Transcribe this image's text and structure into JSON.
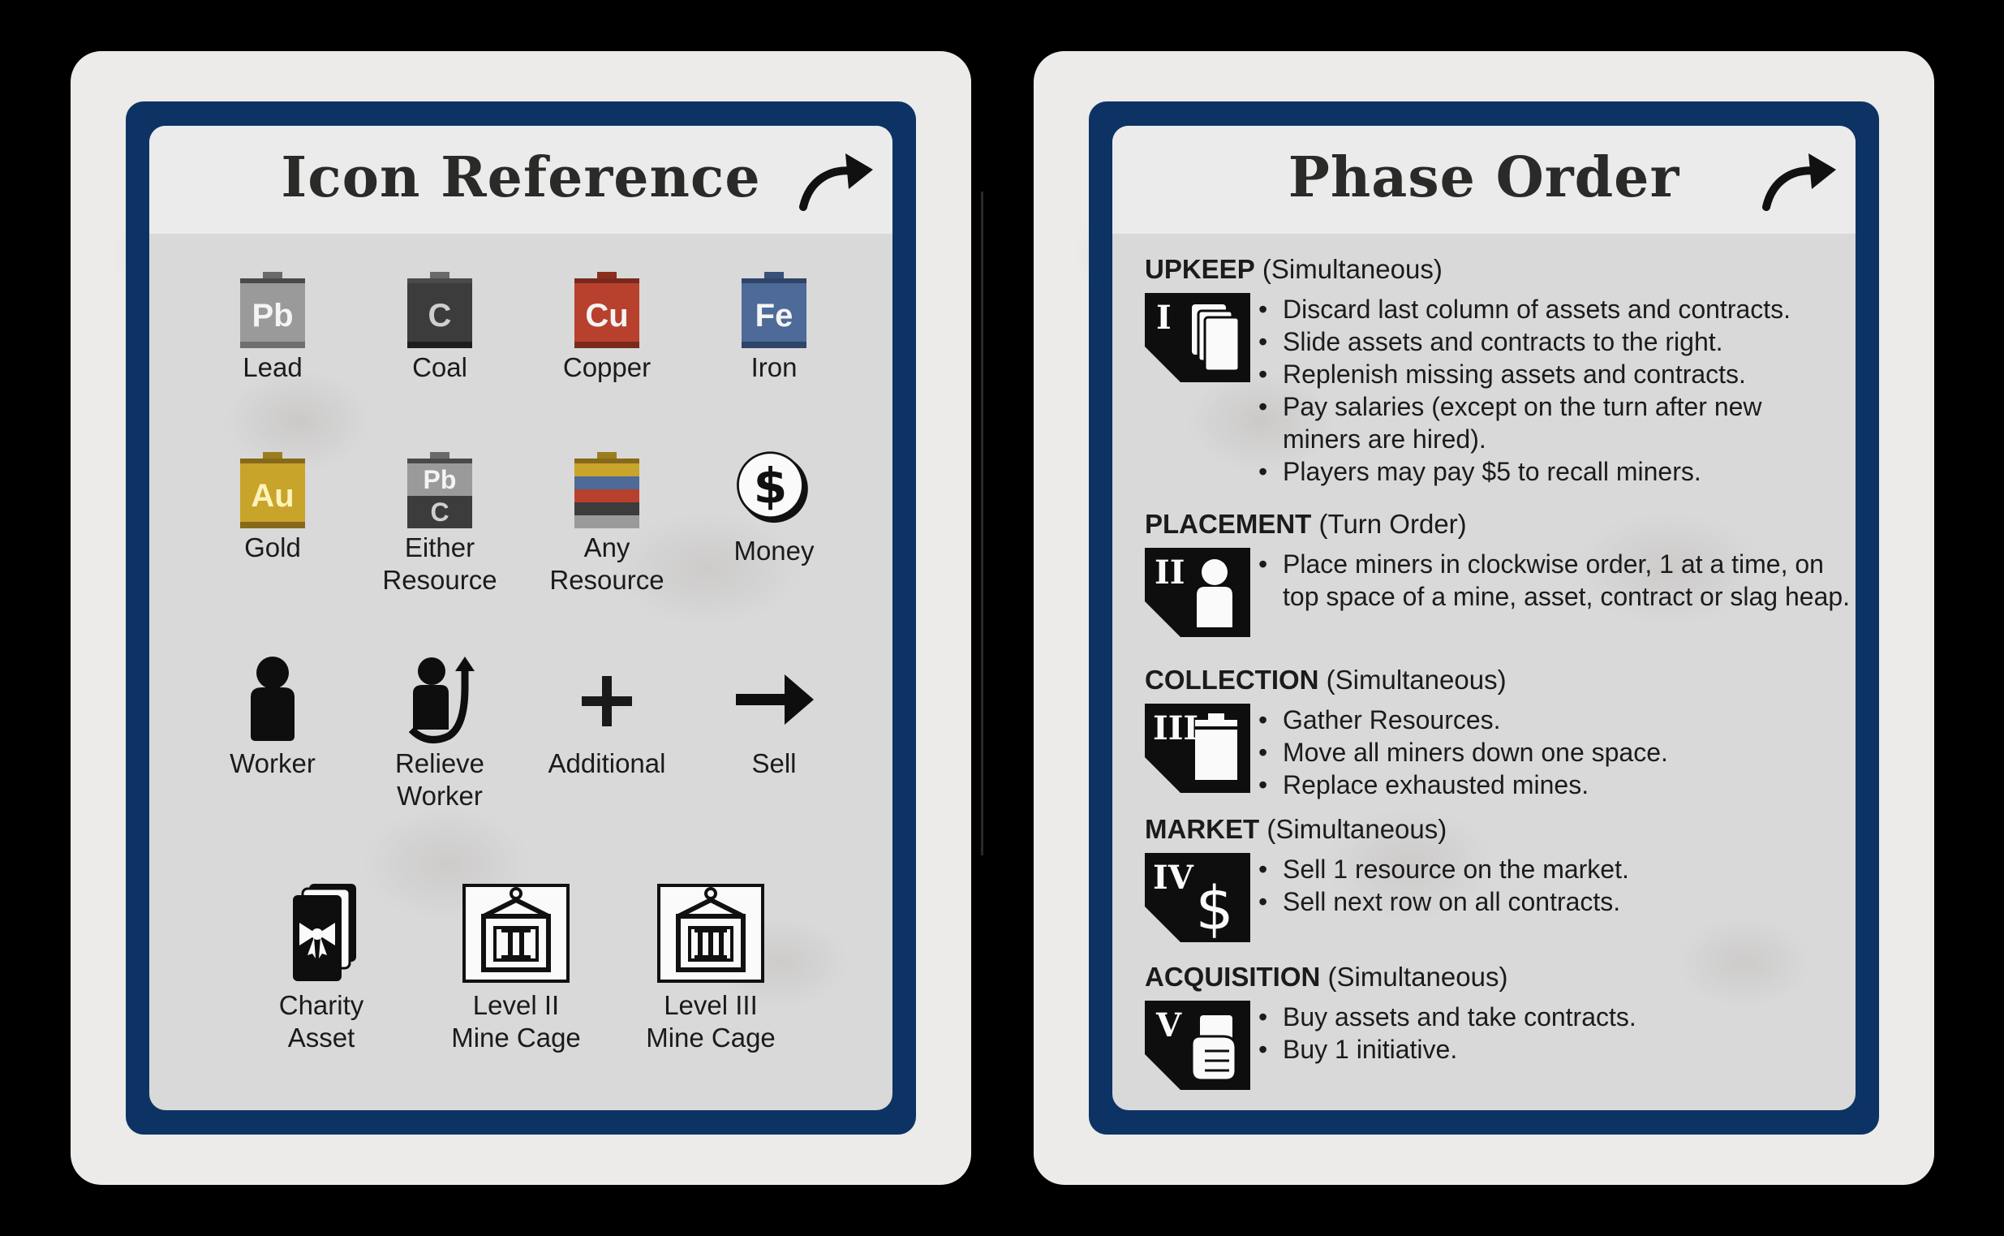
{
  "left_card": {
    "title": "Icon Reference",
    "corner_icon": "turn-arrow-icon",
    "icons": [
      {
        "name": "lead",
        "symbol": "Pb",
        "label": "Lead",
        "color": "#9a9a9a"
      },
      {
        "name": "coal",
        "symbol": "C",
        "label": "Coal",
        "color": "#3c3c3c"
      },
      {
        "name": "copper",
        "symbol": "Cu",
        "label": "Copper",
        "color": "#b8412d"
      },
      {
        "name": "iron",
        "symbol": "Fe",
        "label": "Iron",
        "color": "#4d6a98"
      },
      {
        "name": "gold",
        "symbol": "Au",
        "label": "Gold",
        "color": "#c9a42b"
      },
      {
        "name": "either",
        "symbol_top": "Pb",
        "symbol_bottom": "C",
        "label_line1": "Either",
        "label_line2": "Resource"
      },
      {
        "name": "any",
        "label_line1": "Any",
        "label_line2": "Resource"
      },
      {
        "name": "money",
        "symbol": "$",
        "label": "Money"
      },
      {
        "name": "worker",
        "label": "Worker"
      },
      {
        "name": "relieve-worker",
        "label_line1": "Relieve",
        "label_line2": "Worker"
      },
      {
        "name": "additional",
        "label": "Additional"
      },
      {
        "name": "sell",
        "label": "Sell"
      },
      {
        "name": "charity-asset",
        "label_line1": "Charity",
        "label_line2": "Asset"
      },
      {
        "name": "level-2-cage",
        "label_line1": "Level II",
        "label_line2": "Mine Cage"
      },
      {
        "name": "level-3-cage",
        "label_line1": "Level III",
        "label_line2": "Mine Cage"
      }
    ]
  },
  "right_card": {
    "title": "Phase Order",
    "corner_icon": "turn-arrow-icon",
    "phases": [
      {
        "numeral": "I",
        "name": "UPKEEP",
        "mode": "(Simultaneous)",
        "bullets": [
          "Discard last column of assets and contracts.",
          "Slide assets and contracts to the right.",
          "Replenish missing assets and contracts.",
          "Pay salaries (except on the turn after new miners are hired).",
          "Players may pay $5 to recall miners."
        ]
      },
      {
        "numeral": "II",
        "name": "PLACEMENT",
        "mode": "(Turn Order)",
        "bullets": [
          "Place miners in clockwise order, 1 at a time, on top space of a mine, asset, contract or slag heap."
        ]
      },
      {
        "numeral": "III",
        "name": "COLLECTION",
        "mode": "(Simultaneous)",
        "bullets": [
          "Gather Resources.",
          "Move all miners down one space.",
          "Replace exhausted mines."
        ]
      },
      {
        "numeral": "IV",
        "name": "MARKET",
        "mode": "(Simultaneous)",
        "bullets": [
          "Sell 1 resource on the market.",
          "Sell next row on all contracts."
        ]
      },
      {
        "numeral": "V",
        "name": "ACQUISITION",
        "mode": "(Simultaneous)",
        "bullets": [
          "Buy assets and take contracts.",
          "Buy 1 initiative."
        ]
      }
    ]
  }
}
